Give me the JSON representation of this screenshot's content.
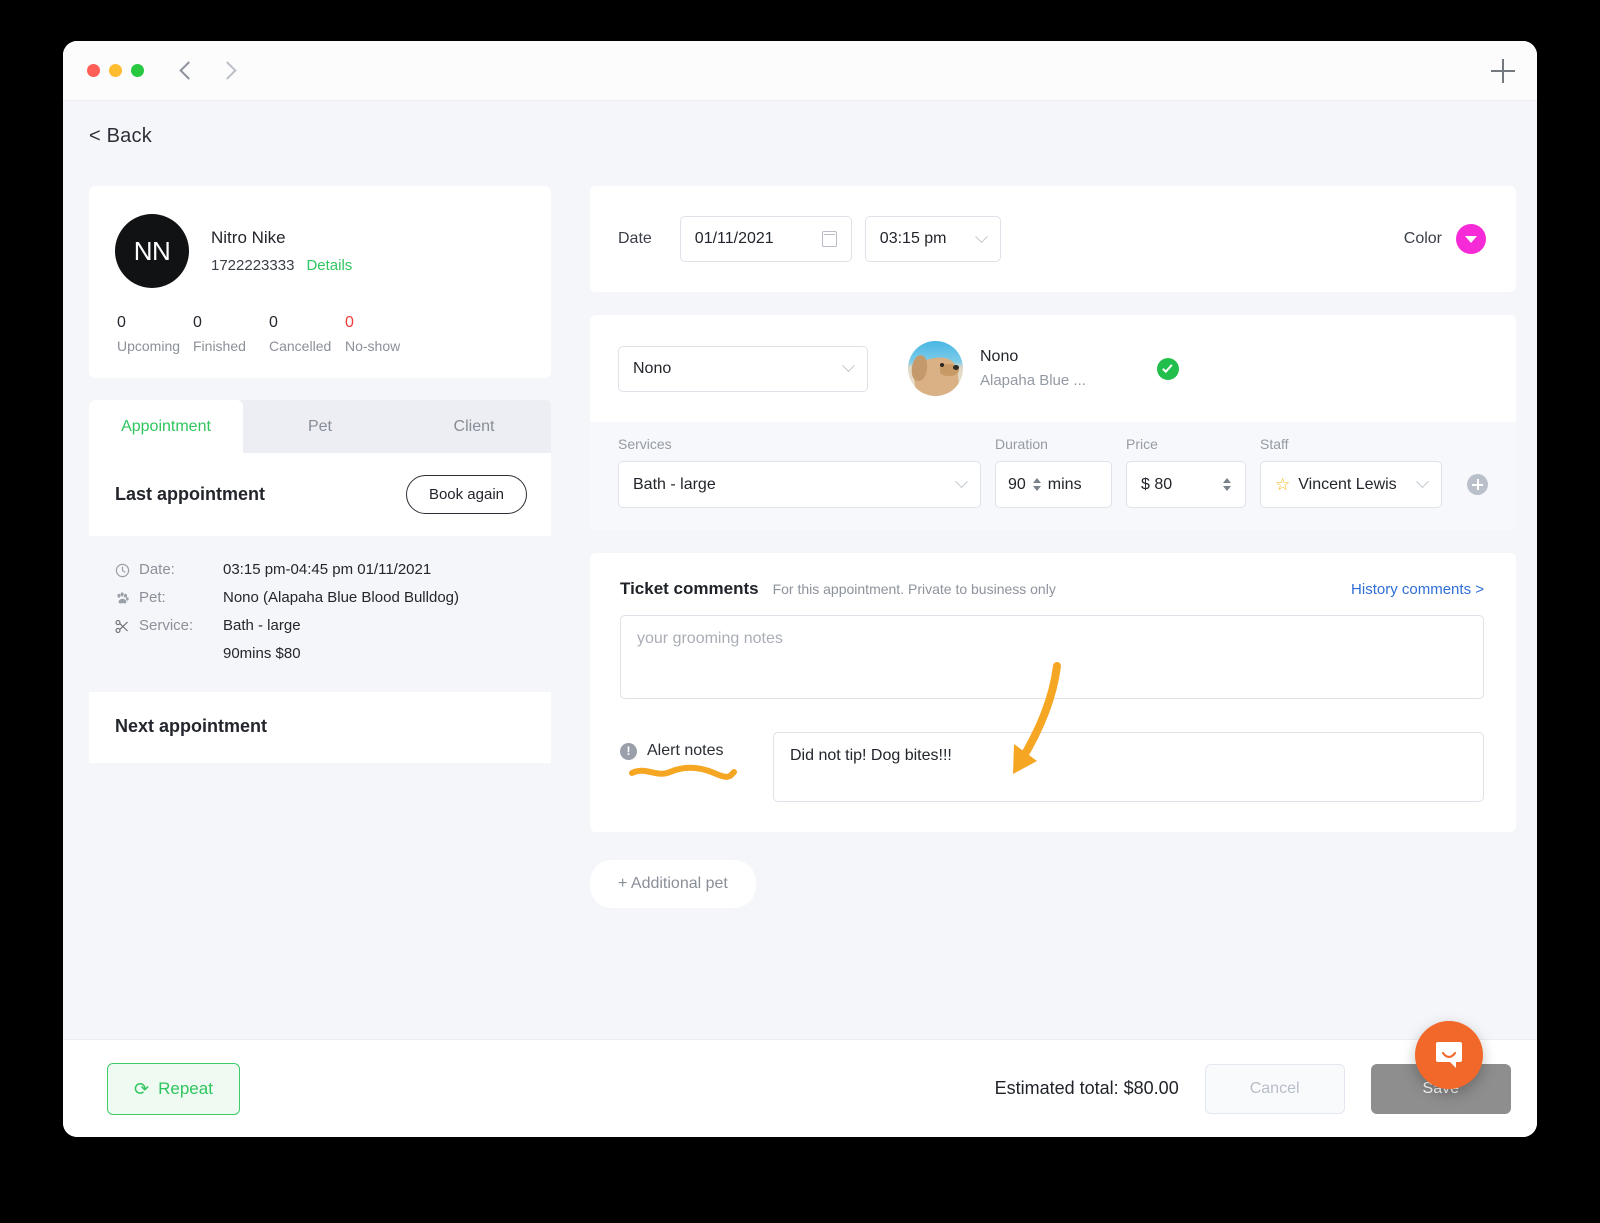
{
  "window": {
    "titlebar": {
      "back_chevron": "nav-back",
      "forward_chevron": "nav-forward",
      "add_label": "+"
    },
    "back_link": "< Back"
  },
  "client": {
    "initials": "NN",
    "name": "Nitro Nike",
    "phone": "1722223333",
    "details_link": "Details",
    "stats": [
      {
        "value": "0",
        "label": "Upcoming",
        "alert": false
      },
      {
        "value": "0",
        "label": "Finished",
        "alert": false
      },
      {
        "value": "0",
        "label": "Cancelled",
        "alert": false
      },
      {
        "value": "0",
        "label": "No-show",
        "alert": true
      }
    ]
  },
  "tabs": [
    {
      "label": "Appointment",
      "active": true
    },
    {
      "label": "Pet",
      "active": false
    },
    {
      "label": "Client",
      "active": false
    }
  ],
  "last_appointment": {
    "title": "Last appointment",
    "book_again": "Book again",
    "rows": [
      {
        "icon": "clock-icon",
        "label": "Date:",
        "value": "03:15 pm-04:45 pm 01/11/2021"
      },
      {
        "icon": "paw-icon",
        "label": "Pet:",
        "value": "Nono (Alapaha Blue Blood Bulldog)"
      },
      {
        "icon": "scissors-icon",
        "label": "Service:",
        "value": "Bath - large"
      }
    ],
    "service_extra": "90mins  $80"
  },
  "next_appointment": {
    "title": "Next appointment"
  },
  "date_panel": {
    "label": "Date",
    "date_value": "01/11/2021",
    "time_value": "03:15 pm",
    "color_label": "Color",
    "color_value": "#f72ad8"
  },
  "pet_panel": {
    "pet_select_value": "Nono",
    "pet_name": "Nono",
    "pet_breed": "Alapaha Blue ...",
    "verified": true,
    "columns": {
      "services": "Services",
      "duration": "Duration",
      "price": "Price",
      "staff": "Staff"
    },
    "service_value": "Bath - large",
    "duration_value": "90",
    "duration_unit": "mins",
    "price_currency": "$",
    "price_value": "80",
    "staff_value": "Vincent Lewis"
  },
  "comments": {
    "title": "Ticket comments",
    "hint": "For this appointment. Private to business only",
    "history_link": "History comments >",
    "grooming_placeholder": "your grooming notes",
    "grooming_value": "",
    "alert_label": "Alert notes",
    "alert_value": "Did not tip! Dog bites!!!",
    "annotation_color": "#f5a623"
  },
  "additional_pet_button": "+ Additional pet",
  "footer": {
    "repeat_label": "Repeat",
    "estimated_total": "Estimated total: $80.00",
    "cancel_label": "Cancel",
    "save_label": "Save"
  },
  "chat_widget": {
    "name": "intercom-launcher"
  }
}
